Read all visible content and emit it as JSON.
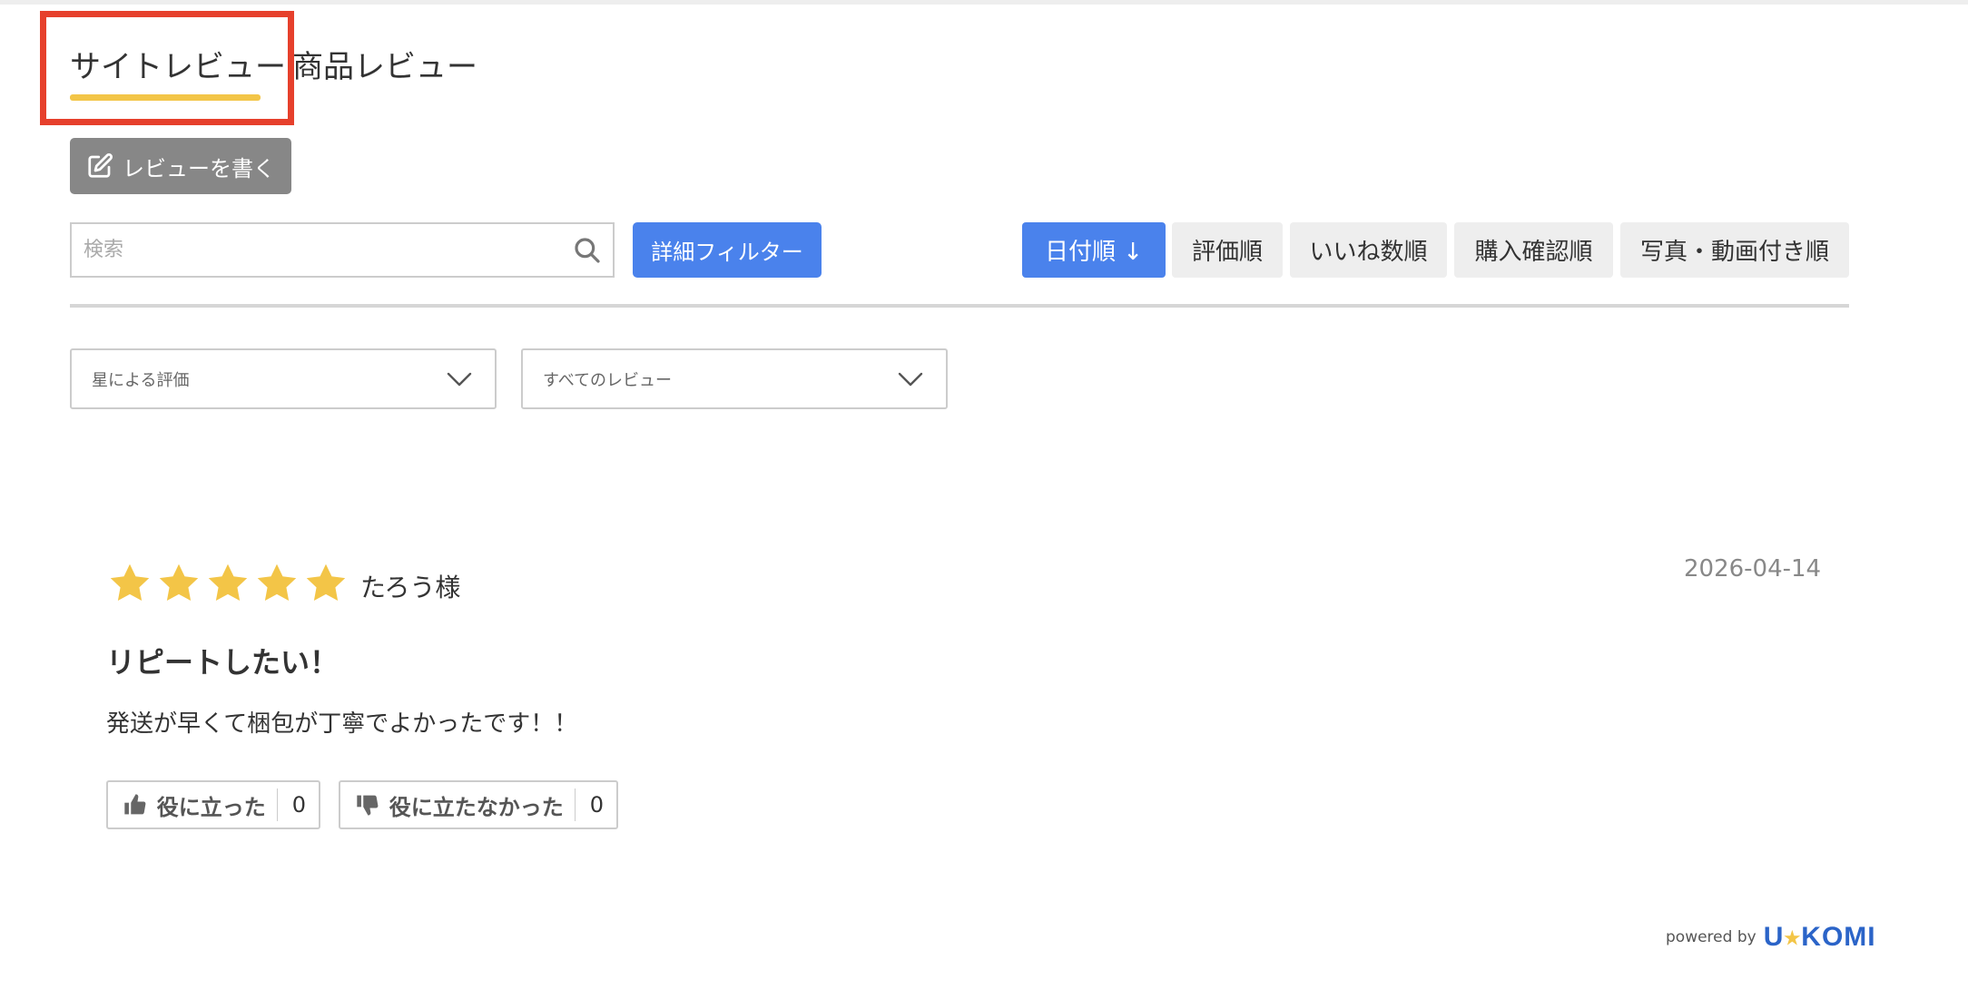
{
  "tabs": {
    "site_review": "サイトレビュー",
    "product_review": "商品レビュー"
  },
  "toolbar": {
    "write_review": "レビューを書く",
    "search_placeholder": "検索",
    "detail_filter": "詳細フィルター"
  },
  "sort": {
    "date": "日付順 ↓",
    "rating": "評価順",
    "likes": "いいね数順",
    "purchase_verified": "購入確認順",
    "with_media": "写真・動画付き順"
  },
  "filters": {
    "star_rating": "星による評価",
    "all_reviews": "すべてのレビュー"
  },
  "review": {
    "rating": 5,
    "reviewer": "たろう様",
    "date": "2026-04-14",
    "title": "リピートしたい！",
    "body": "発送が早くて梱包が丁寧でよかったです！！",
    "helpful_label": "役に立った",
    "helpful_count": "0",
    "unhelpful_label": "役に立たなかった",
    "unhelpful_count": "0"
  },
  "footer": {
    "powered_by": "powered by",
    "logo_left": "U",
    "logo_right": "KOMI"
  },
  "colors": {
    "accent_blue": "#4a82ec",
    "star_yellow": "#f3c547",
    "highlight_red": "#e6402c",
    "write_button_gray": "#878787"
  }
}
